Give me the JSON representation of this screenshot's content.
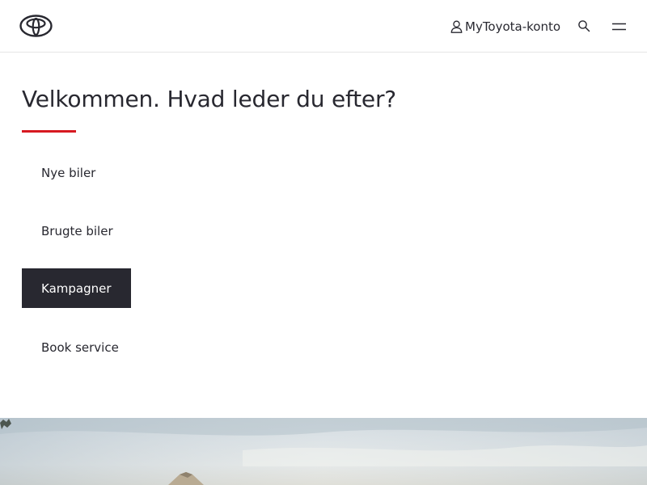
{
  "header": {
    "logo_icon": "toyota-logo-icon",
    "account_label": "MyToyota-konto",
    "account_icon": "user-icon",
    "search_icon": "search-icon",
    "menu_icon": "hamburger-menu-icon"
  },
  "main": {
    "title": "Velkommen. Hvad leder du efter?",
    "accent_color": "#d71921",
    "quick_links": [
      {
        "label": "Nye biler",
        "active": false
      },
      {
        "label": "Brugte biler",
        "active": false
      },
      {
        "label": "Kampagner",
        "active": true
      },
      {
        "label": "Book service",
        "active": false
      }
    ]
  },
  "colors": {
    "text": "#282830",
    "active_bg": "#282830",
    "active_text": "#ffffff",
    "brand_red": "#d71921"
  }
}
